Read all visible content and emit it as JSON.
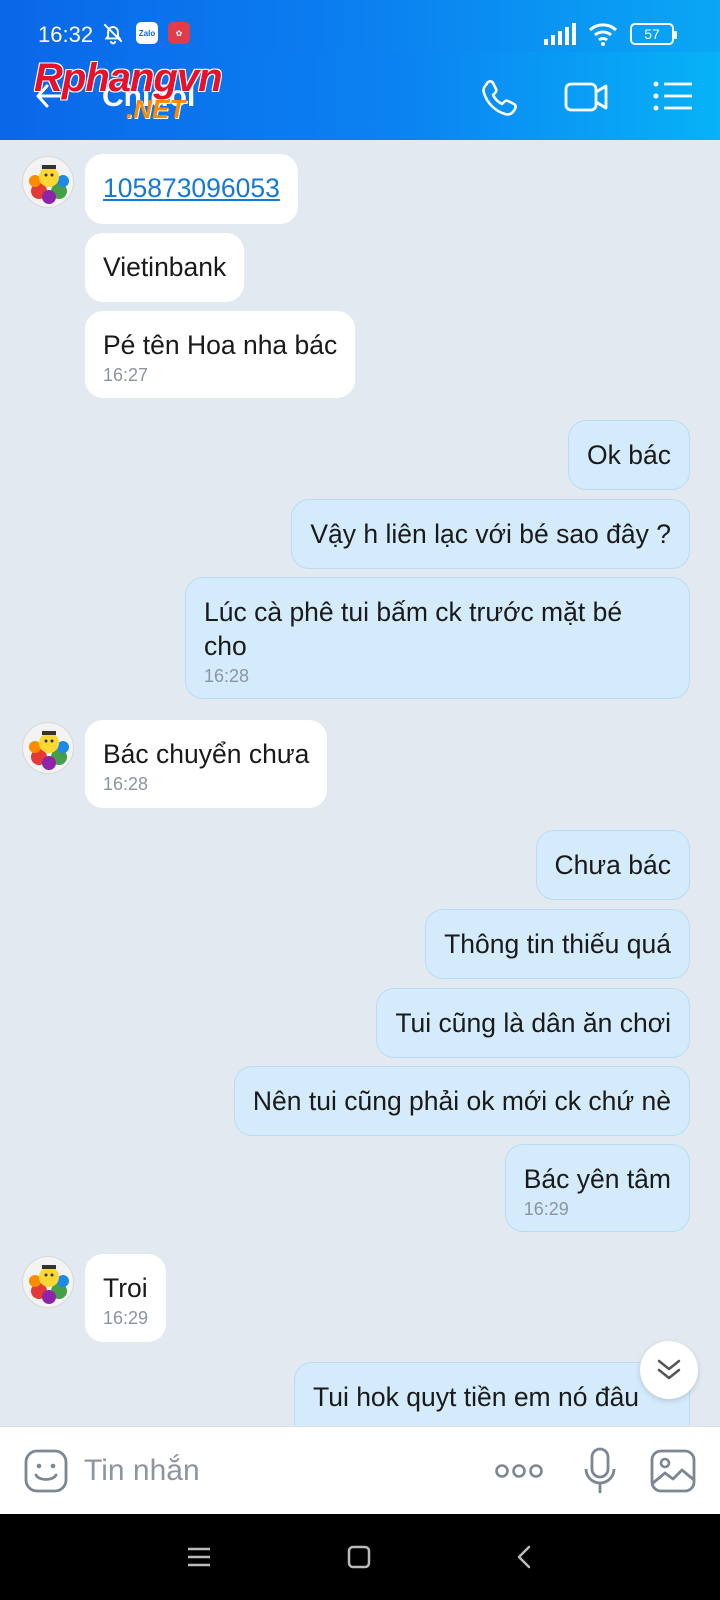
{
  "status_bar": {
    "time": "16:32",
    "battery": "57",
    "app_badge_1": "Zalo"
  },
  "header": {
    "contact_name": "Chidol",
    "watermark_main": "Rphangvn",
    "watermark_sub": ".NET"
  },
  "messages": [
    {
      "side": "in",
      "text": "105873096053",
      "link": true
    },
    {
      "side": "in",
      "text": "Vietinbank"
    },
    {
      "side": "in",
      "text": "Pé tên Hoa nha bác",
      "time": "16:27"
    },
    {
      "side": "out",
      "text": "Ok bác"
    },
    {
      "side": "out",
      "text": "Vậy h liên lạc với bé sao đây ?"
    },
    {
      "side": "out",
      "text_line1": "Lúc cà phê tui bấm ck trước mặt bé",
      "text_line2": "cho",
      "time": "16:28"
    },
    {
      "side": "in",
      "text": "Bác chuyển chưa",
      "time": "16:28"
    },
    {
      "side": "out",
      "text": "Chưa bác"
    },
    {
      "side": "out",
      "text": "Thông tin thiếu quá"
    },
    {
      "side": "out",
      "text": "Tui cũng là dân ăn chơi"
    },
    {
      "side": "out",
      "text": "Nên tui cũng phải ok mới ck chứ nè"
    },
    {
      "side": "out",
      "text": "Bác yên tâm",
      "time": "16:29"
    },
    {
      "side": "in",
      "text": "Troi",
      "time": "16:29"
    },
    {
      "side": "out",
      "text": "Tui hok quyt tiền em nó đâu"
    }
  ],
  "input": {
    "placeholder": "Tin nhắn"
  },
  "colors": {
    "header_start": "#0a67e8",
    "header_end": "#07b2f7",
    "chat_bg": "#e2e9f1",
    "outgoing_bubble": "#d4ebfb",
    "incoming_bubble": "#ffffff",
    "link": "#1479d9"
  },
  "icons": {
    "back": "arrow-left-icon",
    "call": "phone-icon",
    "video": "video-camera-icon",
    "menu": "list-menu-icon",
    "sticker": "smiley-sticker-icon",
    "more": "more-dots-icon",
    "mic": "microphone-icon",
    "image": "image-gallery-icon",
    "scroll": "double-chevron-down-icon"
  }
}
